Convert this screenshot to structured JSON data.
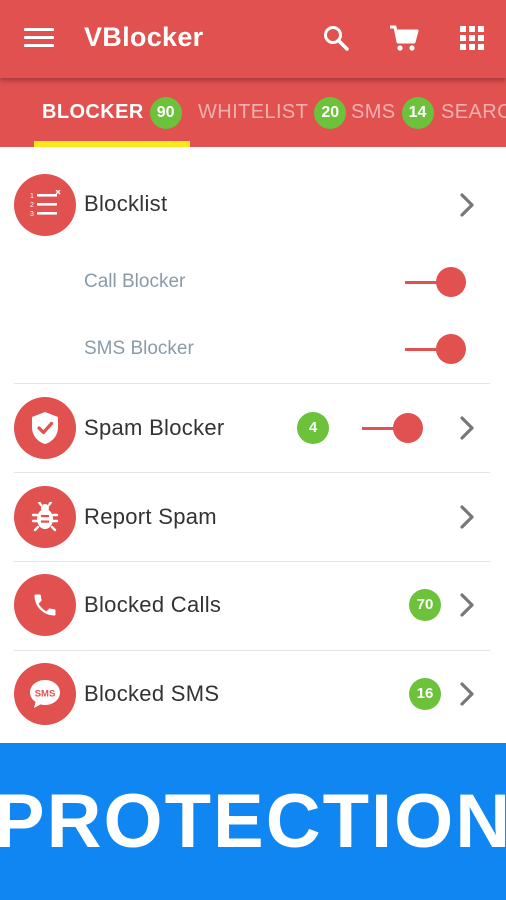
{
  "appbar": {
    "title": "VBlocker",
    "actions": [
      "search-icon",
      "cart-icon",
      "apps-grid-icon"
    ],
    "menu_icon": "menu-icon"
  },
  "tabs": [
    {
      "label": "BLOCKER",
      "badge": "90",
      "active": true
    },
    {
      "label": "WHITELIST",
      "badge": "20",
      "active": false
    },
    {
      "label": "SMS",
      "badge": "14",
      "active": false
    },
    {
      "label": "SEARCH",
      "badge": "",
      "active": false
    }
  ],
  "list": {
    "blocklist": {
      "title": "Blocklist",
      "icon": "blocklist-icon"
    },
    "call_blocker": {
      "label": "Call Blocker",
      "enabled": true
    },
    "sms_blocker": {
      "label": "SMS Blocker",
      "enabled": true
    },
    "spam_blocker": {
      "title": "Spam Blocker",
      "badge": "4",
      "enabled": true,
      "icon": "shield-check-icon"
    },
    "report_spam": {
      "title": "Report Spam",
      "icon": "bug-icon"
    },
    "blocked_calls": {
      "title": "Blocked Calls",
      "badge": "70",
      "icon": "phone-icon"
    },
    "blocked_sms": {
      "title": "Blocked SMS",
      "badge": "16",
      "icon": "sms-bubble-icon",
      "icon_text": "SMS"
    }
  },
  "banner": {
    "text": "PROTECTION"
  },
  "colors": {
    "primary": "#e0514f",
    "badge": "#6cc23a",
    "indicator": "#f9e81c",
    "banner": "#0f86f2"
  }
}
